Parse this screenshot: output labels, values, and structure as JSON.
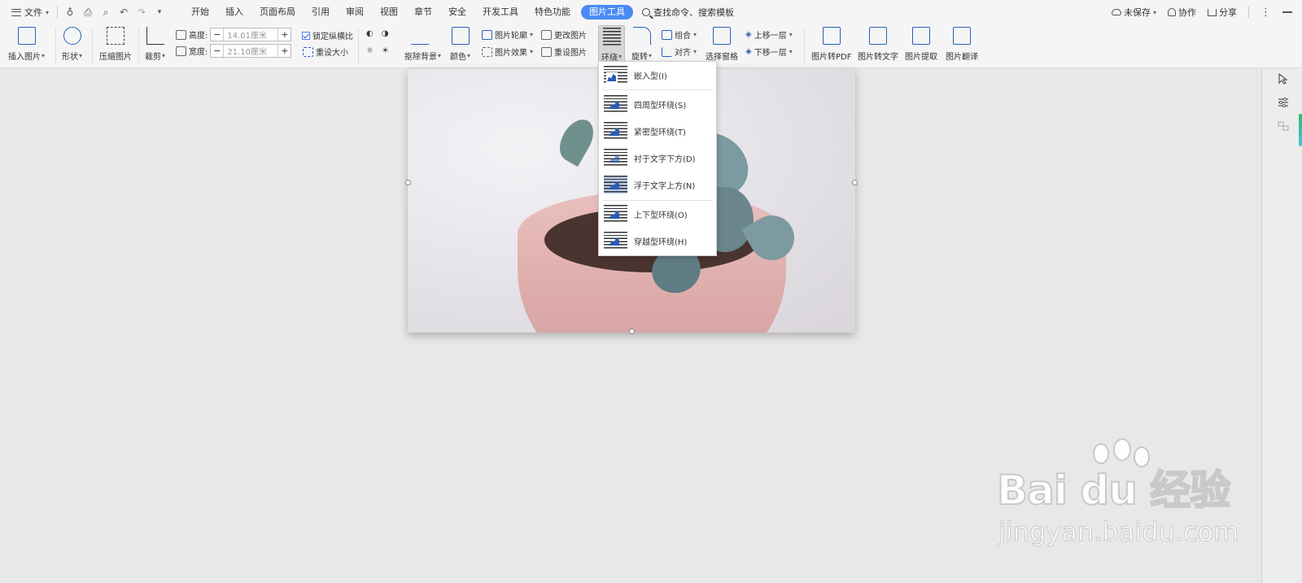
{
  "menubar": {
    "file_label": "文件",
    "tabs": [
      "开始",
      "插入",
      "页面布局",
      "引用",
      "审阅",
      "视图",
      "章节",
      "安全",
      "开发工具",
      "特色功能",
      "图片工具"
    ],
    "active_tab": "图片工具",
    "search_label": "查找命令、搜索模板",
    "unsaved_label": "未保存",
    "collab_label": "协作",
    "share_label": "分享"
  },
  "ribbon": {
    "insert_picture": "插入图片",
    "shape": "形状",
    "compress": "压缩图片",
    "crop": "裁剪",
    "height_label": "高度:",
    "height_value": "14.01厘米",
    "width_label": "宽度:",
    "width_value": "21.10厘米",
    "lock_ratio": "锁定纵横比",
    "reset_size": "重设大小",
    "remove_bg": "抠除背景",
    "color": "颜色",
    "outline": "图片轮廓",
    "effect": "图片效果",
    "change_picture": "更改图片",
    "reset_picture": "重设图片",
    "wrap": "环绕",
    "rotate": "旋转",
    "group": "组合",
    "align": "对齐",
    "selection_pane": "选择窗格",
    "bring_forward": "上移一层",
    "send_backward": "下移一层",
    "to_pdf": "图片转PDF",
    "to_text": "图片转文字",
    "extract": "图片提取",
    "translate": "图片翻译"
  },
  "wrap_menu": {
    "items": [
      "嵌入型(I)",
      "四周型环绕(S)",
      "紧密型环绕(T)",
      "衬于文字下方(D)",
      "浮于文字上方(N)",
      "上下型环绕(O)",
      "穿越型环绕(H)"
    ],
    "highlighted": "浮于文字上方(N)"
  },
  "watermark": {
    "logo_text": "Bai du 经验",
    "url": "jingyan.baidu.com"
  },
  "colors": {
    "accent": "#4a8af4",
    "icon_blue": "#2b5db8",
    "toolbar_bg": "#f5f5f5",
    "canvas_bg": "#e8e8e8"
  }
}
